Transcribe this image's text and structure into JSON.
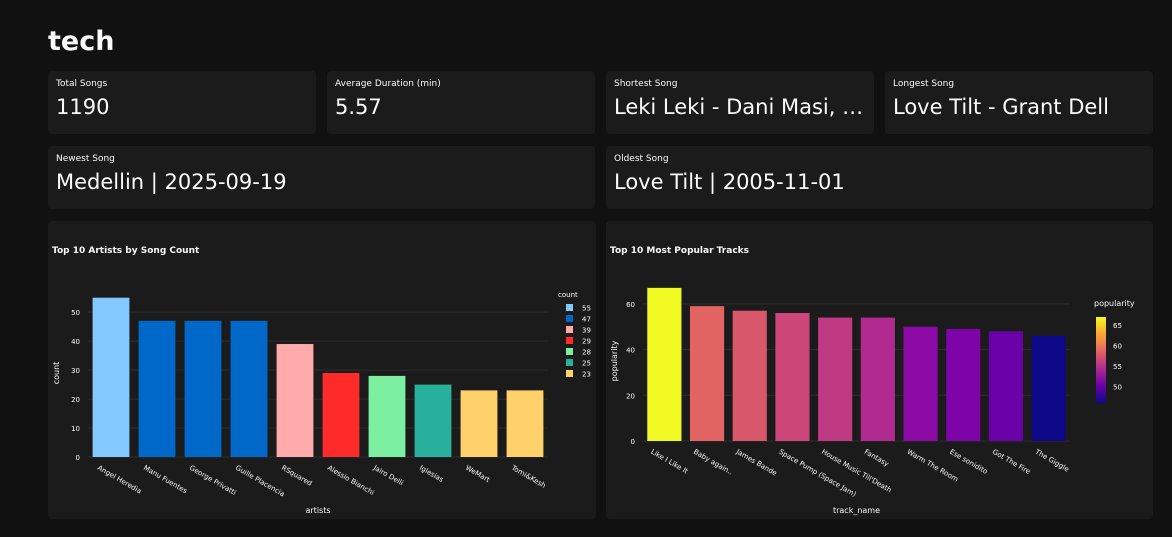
{
  "page": {
    "title": "tech"
  },
  "metrics": {
    "total_songs": {
      "label": "Total Songs",
      "value": "1190"
    },
    "avg_duration": {
      "label": "Average Duration (min)",
      "value": "5.57"
    },
    "shortest_song": {
      "label": "Shortest Song",
      "value": "Leki Leki - Dani Masi, A…"
    },
    "longest_song": {
      "label": "Longest Song",
      "value": "Love Tilt - Grant Dell"
    },
    "newest_song": {
      "label": "Newest Song",
      "value": "Medellin | 2025-09-19"
    },
    "oldest_song": {
      "label": "Oldest Song",
      "value": "Love Tilt | 2005-11-01"
    }
  },
  "chart_data": [
    {
      "type": "bar",
      "title": "Top 10 Artists by Song Count",
      "xlabel": "artists",
      "ylabel": "count",
      "ylim": [
        0,
        58
      ],
      "yticks": [
        0,
        10,
        20,
        30,
        40,
        50
      ],
      "categories": [
        "Angel Heredia",
        "Manu Fuentes",
        "George Privatti",
        "Guille Placencia",
        "RSquared",
        "Alessio Bianchi",
        "Jairo Delli",
        "Iglesias",
        "WeMart",
        "Tomi&Kesh"
      ],
      "values": [
        55,
        47,
        47,
        47,
        39,
        29,
        28,
        25,
        23,
        23
      ],
      "legend": {
        "title": "count",
        "position": "right",
        "entries": [
          {
            "label": "55",
            "color": "#83c9ff"
          },
          {
            "label": "47",
            "color": "#0068c9"
          },
          {
            "label": "39",
            "color": "#ffabab"
          },
          {
            "label": "29",
            "color": "#ff2b2b"
          },
          {
            "label": "28",
            "color": "#7defa1"
          },
          {
            "label": "25",
            "color": "#29b09d"
          },
          {
            "label": "23",
            "color": "#ffd16a"
          }
        ]
      },
      "colors": [
        "#83c9ff",
        "#0068c9",
        "#0068c9",
        "#0068c9",
        "#ffabab",
        "#ff2b2b",
        "#7defa1",
        "#29b09d",
        "#ffd16a",
        "#ffd16a"
      ]
    },
    {
      "type": "bar",
      "title": "Top 10 Most Popular Tracks",
      "xlabel": "track_name",
      "ylabel": "popularity",
      "ylim": [
        0,
        70
      ],
      "yticks": [
        0,
        20,
        40,
        60
      ],
      "categories": [
        "Like I Like It",
        "Baby again..",
        "James Bande",
        "Space Pump (Space Jam)",
        "House Music Till'Death",
        "Fantasy",
        "Warm The Room",
        "Ese sonidito",
        "Got The Fire",
        "The Giggle"
      ],
      "values": [
        67,
        59,
        57,
        56,
        54,
        54,
        50,
        49,
        48,
        46
      ],
      "colors": [
        "#f0f921",
        "#e16462",
        "#d8576b",
        "#cc4778",
        "#c03a83",
        "#b12a90",
        "#8b0aa5",
        "#7e03a8",
        "#6a00a8",
        "#0d0887"
      ],
      "colorbar": {
        "title": "popularity",
        "ticks": [
          "65",
          "60",
          "55",
          "50"
        ],
        "tick_values": [
          65,
          60,
          55,
          50
        ],
        "range": [
          46,
          67
        ]
      }
    }
  ]
}
